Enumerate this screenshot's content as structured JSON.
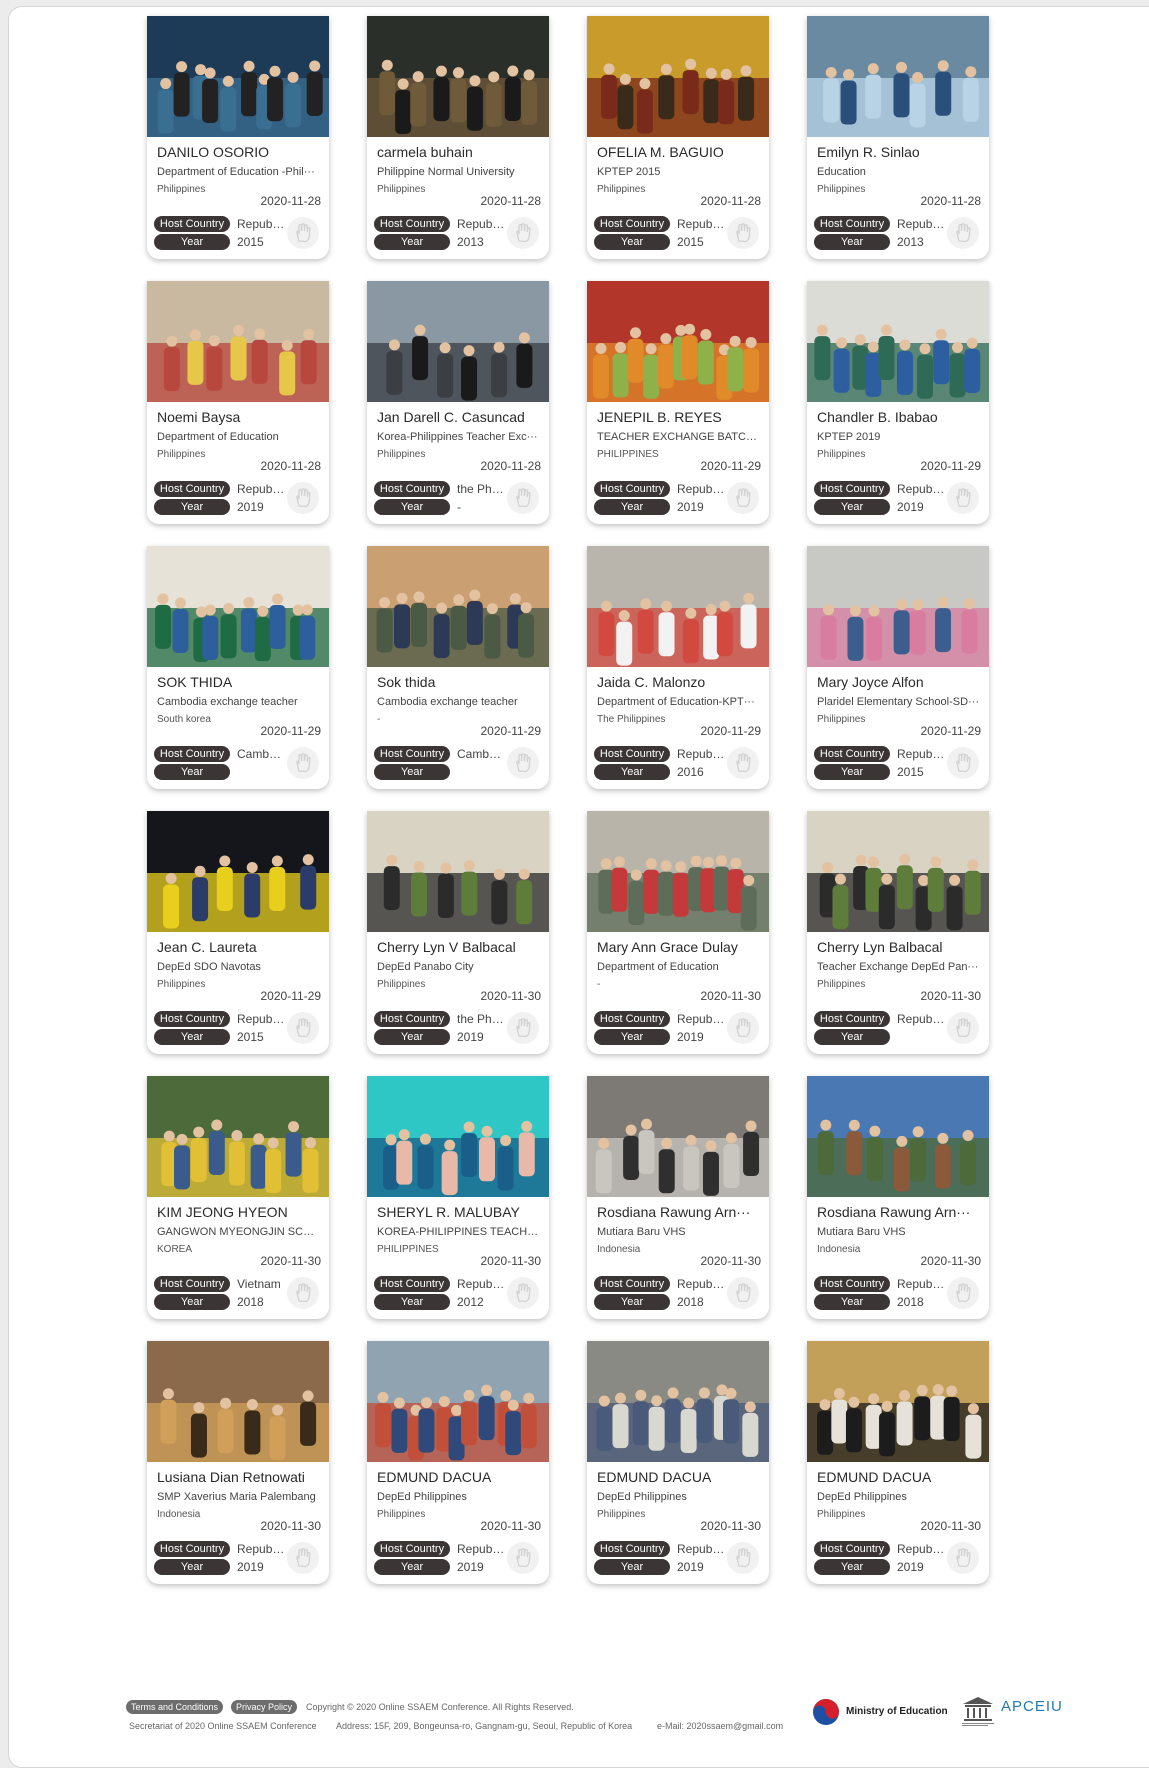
{
  "labels": {
    "host_country": "Host Country",
    "year": "Year"
  },
  "cards": [
    {
      "name": "DANILO OSORIO",
      "org": "Department of Education -Phil···",
      "country": "Philippines",
      "date": "2020-11-28",
      "host": "Republi···",
      "year": "2015",
      "photo": "conference-panel"
    },
    {
      "name": "carmela buhain",
      "org": "Philippine Normal University",
      "country": "Philippines",
      "date": "2020-11-28",
      "host": "Republi···",
      "year": "2013",
      "photo": "group-banner"
    },
    {
      "name": "OFELIA M. BAGUIO",
      "org": "KPTEP 2015",
      "country": "Philippines",
      "date": "2020-11-28",
      "host": "Republi···",
      "year": "2015",
      "photo": "presentation"
    },
    {
      "name": "Emilyn R. Sinlao",
      "org": "Education",
      "country": "Philippines",
      "date": "2020-11-28",
      "host": "Republi···",
      "year": "2013",
      "photo": "hanbok-certificate"
    },
    {
      "name": "Noemi Baysa",
      "org": "Department of Education",
      "country": "Philippines",
      "date": "2020-11-28",
      "host": "Republi···",
      "year": "2019",
      "photo": "group-costumes"
    },
    {
      "name": "Jan Darell C. Casuncad",
      "org": "Korea-Philippines Teacher Exc···",
      "country": "Philippines",
      "date": "2020-11-28",
      "host": "the Phil···",
      "year": "-",
      "photo": "group-outdoor"
    },
    {
      "name": "JENEPIL B. REYES",
      "org": "TEACHER EXCHANGE BATCH ···",
      "country": "PHILIPPINES",
      "date": "2020-11-29",
      "host": "Republi···",
      "year": "2019",
      "photo": "hanbok-autumn"
    },
    {
      "name": "Chandler B. Ibabao",
      "org": "KPTEP 2019",
      "country": "Philippines",
      "date": "2020-11-29",
      "host": "Republi···",
      "year": "2019",
      "photo": "classroom"
    },
    {
      "name": "SOK THIDA",
      "org": "Cambodia exchange teacher",
      "country": "South korea",
      "date": "2020-11-29",
      "host": "Cambo···",
      "year": "",
      "photo": "classroom-green"
    },
    {
      "name": "Sok thida",
      "org": "Cambodia exchange teacher",
      "country": "-",
      "date": "2020-11-29",
      "host": "Cambo···",
      "year": "",
      "photo": "classroom-blinds"
    },
    {
      "name": "Jaida C. Malonzo",
      "org": "Department of Education-KPT···",
      "country": "The Philippines",
      "date": "2020-11-29",
      "host": "Republi···",
      "year": "2016",
      "photo": "kids-group"
    },
    {
      "name": "Mary Joyce Alfon",
      "org": "Plaridel Elementary School-SD···",
      "country": "Philippines",
      "date": "2020-11-29",
      "host": "Republi···",
      "year": "2015",
      "photo": "kids-hanbok"
    },
    {
      "name": "Jean C. Laureta",
      "org": "DepEd SDO Navotas",
      "country": "Philippines",
      "date": "2020-11-29",
      "host": "Republi···",
      "year": "2015",
      "photo": "stage-yellow"
    },
    {
      "name": "Cherry Lyn V Balbacal",
      "org": "DepEd Panabo City",
      "country": "Philippines",
      "date": "2020-11-30",
      "host": "the Phil···",
      "year": "2019",
      "photo": "group-dark"
    },
    {
      "name": "Mary Ann Grace Dulay",
      "org": "Department of Education",
      "country": "-",
      "date": "2020-11-30",
      "host": "Republi···",
      "year": "2019",
      "photo": "flags-hall"
    },
    {
      "name": "Cherry Lyn Balbacal",
      "org": "Teacher Exchange DepEd Pan···",
      "country": "Philippines",
      "date": "2020-11-30",
      "host": "Republi···",
      "year": "",
      "photo": "group-dark"
    },
    {
      "name": "KIM JEONG HYEON",
      "org": "GANGWON MYEONGJIN SCHO···",
      "country": "KOREA",
      "date": "2020-11-30",
      "host": "Vietnam",
      "year": "2018",
      "photo": "selfie-kids"
    },
    {
      "name": "SHERYL R. MALUBAY",
      "org": "KOREA-PHILIPPINES TEACHER···",
      "country": "PHILIPPINES",
      "date": "2020-11-30",
      "host": "Republi···",
      "year": "2012",
      "photo": "kids-frame"
    },
    {
      "name": "Rosdiana Rawung Arn···",
      "org": "Mutiara Baru VHS",
      "country": "Indonesia",
      "date": "2020-11-30",
      "host": "Republi···",
      "year": "2018",
      "photo": "cooking"
    },
    {
      "name": "Rosdiana Rawung Arn···",
      "org": "Mutiara Baru VHS",
      "country": "Indonesia",
      "date": "2020-11-30",
      "host": "Republi···",
      "year": "2018",
      "photo": "palace"
    },
    {
      "name": "Lusiana Dian Retnowati",
      "org": "SMP Xaverius Maria Palembang",
      "country": "Indonesia",
      "date": "2020-11-30",
      "host": "Republi···",
      "year": "2019",
      "photo": "library"
    },
    {
      "name": "EDMUND DACUA",
      "org": "DepEd Philippines",
      "country": "Philippines",
      "date": "2020-11-30",
      "host": "Republi···",
      "year": "2019",
      "photo": "classroom-kids"
    },
    {
      "name": "EDMUND DACUA",
      "org": "DepEd Philippines",
      "country": "Philippines",
      "date": "2020-11-30",
      "host": "Republi···",
      "year": "2019",
      "photo": "classroom-kids2"
    },
    {
      "name": "EDMUND DACUA",
      "org": "DepEd Philippines",
      "country": "Philippines",
      "date": "2020-11-30",
      "host": "Republi···",
      "year": "2019",
      "photo": "group-black"
    }
  ],
  "footer": {
    "terms": "Terms and Conditions",
    "privacy": "Privacy Policy",
    "copyright": "Copyright © 2020 Online SSAEM Conference. All Rights Reserved.",
    "secretariat": "Secretariat of 2020 Online SSAEM Conference",
    "address": "Address: 15F, 209, Bongeunsa-ro, Gangnam-gu, Seoul, Republic of Korea",
    "email": "e-Mail: 2020ssaem@gmail.com",
    "ministry": "Ministry of Education",
    "apceiu": "APCEIU"
  }
}
